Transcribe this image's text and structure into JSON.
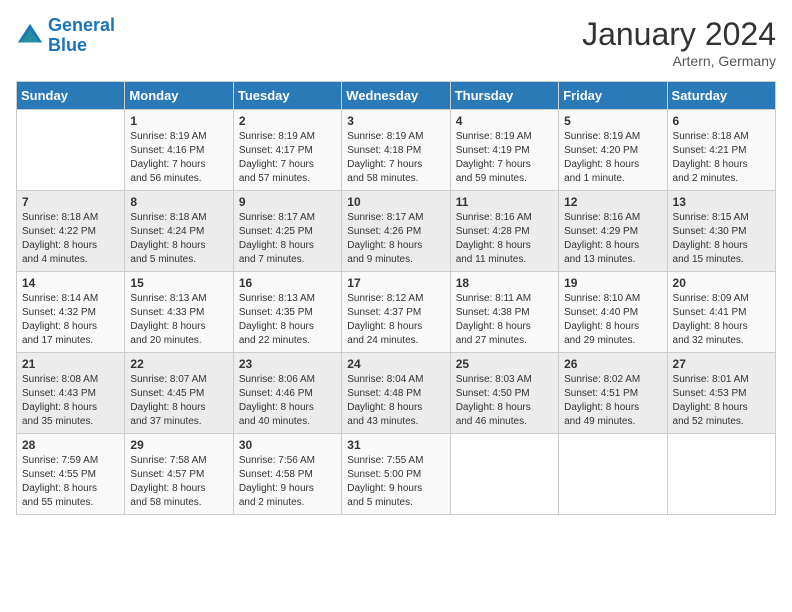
{
  "header": {
    "logo_line1": "General",
    "logo_line2": "Blue",
    "month": "January 2024",
    "location": "Artern, Germany"
  },
  "days_of_week": [
    "Sunday",
    "Monday",
    "Tuesday",
    "Wednesday",
    "Thursday",
    "Friday",
    "Saturday"
  ],
  "weeks": [
    [
      {
        "day": "",
        "info": ""
      },
      {
        "day": "1",
        "info": "Sunrise: 8:19 AM\nSunset: 4:16 PM\nDaylight: 7 hours\nand 56 minutes."
      },
      {
        "day": "2",
        "info": "Sunrise: 8:19 AM\nSunset: 4:17 PM\nDaylight: 7 hours\nand 57 minutes."
      },
      {
        "day": "3",
        "info": "Sunrise: 8:19 AM\nSunset: 4:18 PM\nDaylight: 7 hours\nand 58 minutes."
      },
      {
        "day": "4",
        "info": "Sunrise: 8:19 AM\nSunset: 4:19 PM\nDaylight: 7 hours\nand 59 minutes."
      },
      {
        "day": "5",
        "info": "Sunrise: 8:19 AM\nSunset: 4:20 PM\nDaylight: 8 hours\nand 1 minute."
      },
      {
        "day": "6",
        "info": "Sunrise: 8:18 AM\nSunset: 4:21 PM\nDaylight: 8 hours\nand 2 minutes."
      }
    ],
    [
      {
        "day": "7",
        "info": "Sunrise: 8:18 AM\nSunset: 4:22 PM\nDaylight: 8 hours\nand 4 minutes."
      },
      {
        "day": "8",
        "info": "Sunrise: 8:18 AM\nSunset: 4:24 PM\nDaylight: 8 hours\nand 5 minutes."
      },
      {
        "day": "9",
        "info": "Sunrise: 8:17 AM\nSunset: 4:25 PM\nDaylight: 8 hours\nand 7 minutes."
      },
      {
        "day": "10",
        "info": "Sunrise: 8:17 AM\nSunset: 4:26 PM\nDaylight: 8 hours\nand 9 minutes."
      },
      {
        "day": "11",
        "info": "Sunrise: 8:16 AM\nSunset: 4:28 PM\nDaylight: 8 hours\nand 11 minutes."
      },
      {
        "day": "12",
        "info": "Sunrise: 8:16 AM\nSunset: 4:29 PM\nDaylight: 8 hours\nand 13 minutes."
      },
      {
        "day": "13",
        "info": "Sunrise: 8:15 AM\nSunset: 4:30 PM\nDaylight: 8 hours\nand 15 minutes."
      }
    ],
    [
      {
        "day": "14",
        "info": "Sunrise: 8:14 AM\nSunset: 4:32 PM\nDaylight: 8 hours\nand 17 minutes."
      },
      {
        "day": "15",
        "info": "Sunrise: 8:13 AM\nSunset: 4:33 PM\nDaylight: 8 hours\nand 20 minutes."
      },
      {
        "day": "16",
        "info": "Sunrise: 8:13 AM\nSunset: 4:35 PM\nDaylight: 8 hours\nand 22 minutes."
      },
      {
        "day": "17",
        "info": "Sunrise: 8:12 AM\nSunset: 4:37 PM\nDaylight: 8 hours\nand 24 minutes."
      },
      {
        "day": "18",
        "info": "Sunrise: 8:11 AM\nSunset: 4:38 PM\nDaylight: 8 hours\nand 27 minutes."
      },
      {
        "day": "19",
        "info": "Sunrise: 8:10 AM\nSunset: 4:40 PM\nDaylight: 8 hours\nand 29 minutes."
      },
      {
        "day": "20",
        "info": "Sunrise: 8:09 AM\nSunset: 4:41 PM\nDaylight: 8 hours\nand 32 minutes."
      }
    ],
    [
      {
        "day": "21",
        "info": "Sunrise: 8:08 AM\nSunset: 4:43 PM\nDaylight: 8 hours\nand 35 minutes."
      },
      {
        "day": "22",
        "info": "Sunrise: 8:07 AM\nSunset: 4:45 PM\nDaylight: 8 hours\nand 37 minutes."
      },
      {
        "day": "23",
        "info": "Sunrise: 8:06 AM\nSunset: 4:46 PM\nDaylight: 8 hours\nand 40 minutes."
      },
      {
        "day": "24",
        "info": "Sunrise: 8:04 AM\nSunset: 4:48 PM\nDaylight: 8 hours\nand 43 minutes."
      },
      {
        "day": "25",
        "info": "Sunrise: 8:03 AM\nSunset: 4:50 PM\nDaylight: 8 hours\nand 46 minutes."
      },
      {
        "day": "26",
        "info": "Sunrise: 8:02 AM\nSunset: 4:51 PM\nDaylight: 8 hours\nand 49 minutes."
      },
      {
        "day": "27",
        "info": "Sunrise: 8:01 AM\nSunset: 4:53 PM\nDaylight: 8 hours\nand 52 minutes."
      }
    ],
    [
      {
        "day": "28",
        "info": "Sunrise: 7:59 AM\nSunset: 4:55 PM\nDaylight: 8 hours\nand 55 minutes."
      },
      {
        "day": "29",
        "info": "Sunrise: 7:58 AM\nSunset: 4:57 PM\nDaylight: 8 hours\nand 58 minutes."
      },
      {
        "day": "30",
        "info": "Sunrise: 7:56 AM\nSunset: 4:58 PM\nDaylight: 9 hours\nand 2 minutes."
      },
      {
        "day": "31",
        "info": "Sunrise: 7:55 AM\nSunset: 5:00 PM\nDaylight: 9 hours\nand 5 minutes."
      },
      {
        "day": "",
        "info": ""
      },
      {
        "day": "",
        "info": ""
      },
      {
        "day": "",
        "info": ""
      }
    ]
  ]
}
